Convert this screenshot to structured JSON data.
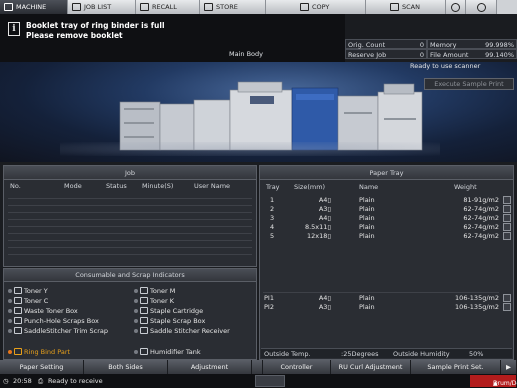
{
  "tabs": [
    {
      "label": "MACHINE",
      "icon": "machine-icon",
      "active": true
    },
    {
      "label": "JOB LIST",
      "icon": "job-list-icon"
    },
    {
      "label": "RECALL",
      "icon": "recall-icon"
    },
    {
      "label": "STORE",
      "icon": "store-icon"
    },
    {
      "label": "COPY",
      "icon": "copy-icon"
    },
    {
      "label": "SCAN",
      "icon": "scan-icon"
    }
  ],
  "message": {
    "line1": "Booklet tray of ring binder is full",
    "line2": "Please remove booklet"
  },
  "main_body_label": "Main Body",
  "status": {
    "orig_count_label": "Orig. Count",
    "orig_count": "0",
    "memory_label": "Memory",
    "memory": "99.998%",
    "reserve_job_label": "Reserve Job",
    "reserve_job": "0",
    "file_amount_label": "File Amount",
    "file_amount": "99.140%"
  },
  "scanner_status": "Ready to use scanner",
  "execute_sample_print": "Execute Sample Print",
  "job_panel": {
    "title": "Job",
    "columns": [
      "No.",
      "Mode",
      "Status",
      "Minute(S)",
      "User Name"
    ]
  },
  "consumables": {
    "title": "Consumable and Scrap Indicators",
    "items": [
      {
        "label": "Toner Y"
      },
      {
        "label": "Toner M"
      },
      {
        "label": "Toner C"
      },
      {
        "label": "Toner K"
      },
      {
        "label": "Waste Toner Box"
      },
      {
        "label": "Staple Cartridge"
      },
      {
        "label": "Punch-Hole Scraps Box"
      },
      {
        "label": "Staple Scrap Box"
      },
      {
        "label": "SaddleStitcher Trim Scrap"
      },
      {
        "label": "Saddle Stitcher Receiver"
      },
      {
        "label": "Ring Bind Part",
        "alert": true
      },
      {
        "label": "Humidifier Tank"
      }
    ]
  },
  "paper_tray": {
    "title": "Paper Tray",
    "columns": [
      "Tray",
      "Size(mm)",
      "Name",
      "Weight"
    ],
    "rows": [
      {
        "tray": "1",
        "size": "A4▯",
        "name": "Plain",
        "weight": "81-91g/m2"
      },
      {
        "tray": "2",
        "size": "A3▯",
        "name": "Plain",
        "weight": "62-74g/m2"
      },
      {
        "tray": "3",
        "size": "A4▯",
        "name": "Plain",
        "weight": "62-74g/m2"
      },
      {
        "tray": "4",
        "size": "8.5x11▯",
        "name": "Plain",
        "weight": "62-74g/m2"
      },
      {
        "tray": "5",
        "size": "12x18▯",
        "name": "Plain",
        "weight": "62-74g/m2"
      },
      {
        "tray": "PI1",
        "size": "A4▯",
        "name": "Plain",
        "weight": "106-135g/m2"
      },
      {
        "tray": "PI2",
        "size": "A3▯",
        "name": "Plain",
        "weight": "106-135g/m2"
      }
    ],
    "outside_temp_label": "Outside Temp.",
    "outside_temp": ":25Degrees",
    "outside_humidity_label": "Outside Humidity",
    "outside_humidity": "50%"
  },
  "function_bar": [
    "Paper Setting",
    "Both Sides",
    "Adjustment",
    "",
    "Controller",
    "RU Curl Adjustment",
    "Sample Print Set."
  ],
  "statusbar": {
    "time": "20:58",
    "status": "Ready to receive",
    "drum": "Drum/Dev."
  }
}
